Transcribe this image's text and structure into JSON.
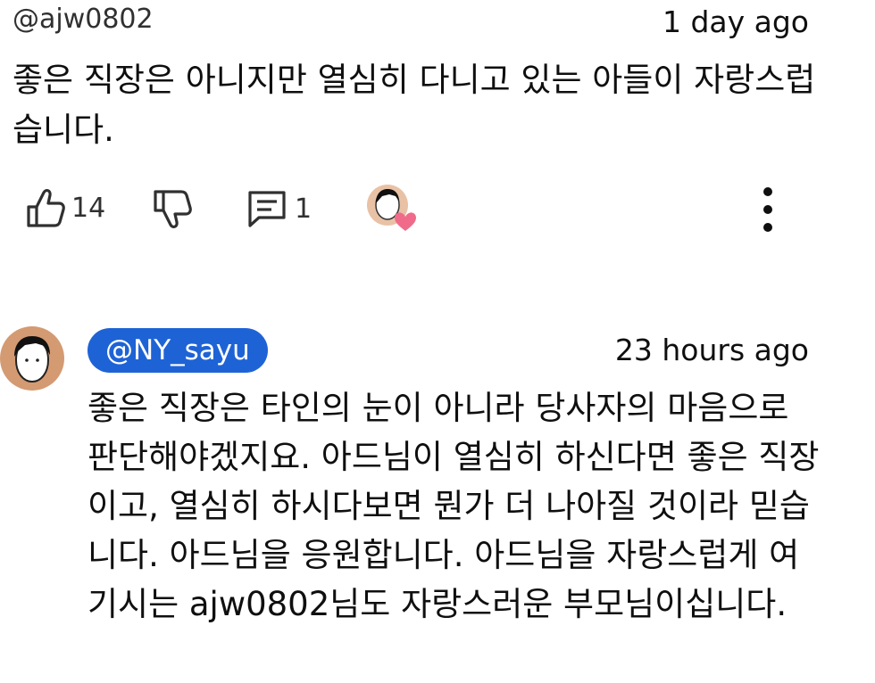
{
  "comment": {
    "author": "@ajw0802",
    "time": "1 day ago",
    "text": "좋은 직장은 아니지만 열심히 다니고 있는 아들이 자랑스럽습니다.",
    "likes": "14",
    "replies": "1"
  },
  "reply": {
    "author": "@NY_sayu",
    "time": "23 hours ago",
    "text": "좋은 직장은 타인의 눈이 아니라 당사자의 마음으로 판단해야겠지요. 아드님이 열심히 하신다면 좋은 직장이고, 열심히 하시다보면 뭔가 더 나아질 것이라 믿습니다. 아드님을 응원합니다. 아드님을 자랑스럽게 여기시는 ajw0802님도 자랑스러운 부모님이십니다."
  },
  "icons": {
    "like": "thumbs-up-icon",
    "dislike": "thumbs-down-icon",
    "reply": "comment-icon",
    "creator_heart": "creator-heart-icon",
    "more": "more-vertical-icon"
  },
  "colors": {
    "author_chip": "#1e63d6",
    "heart": "#f06b8a"
  }
}
